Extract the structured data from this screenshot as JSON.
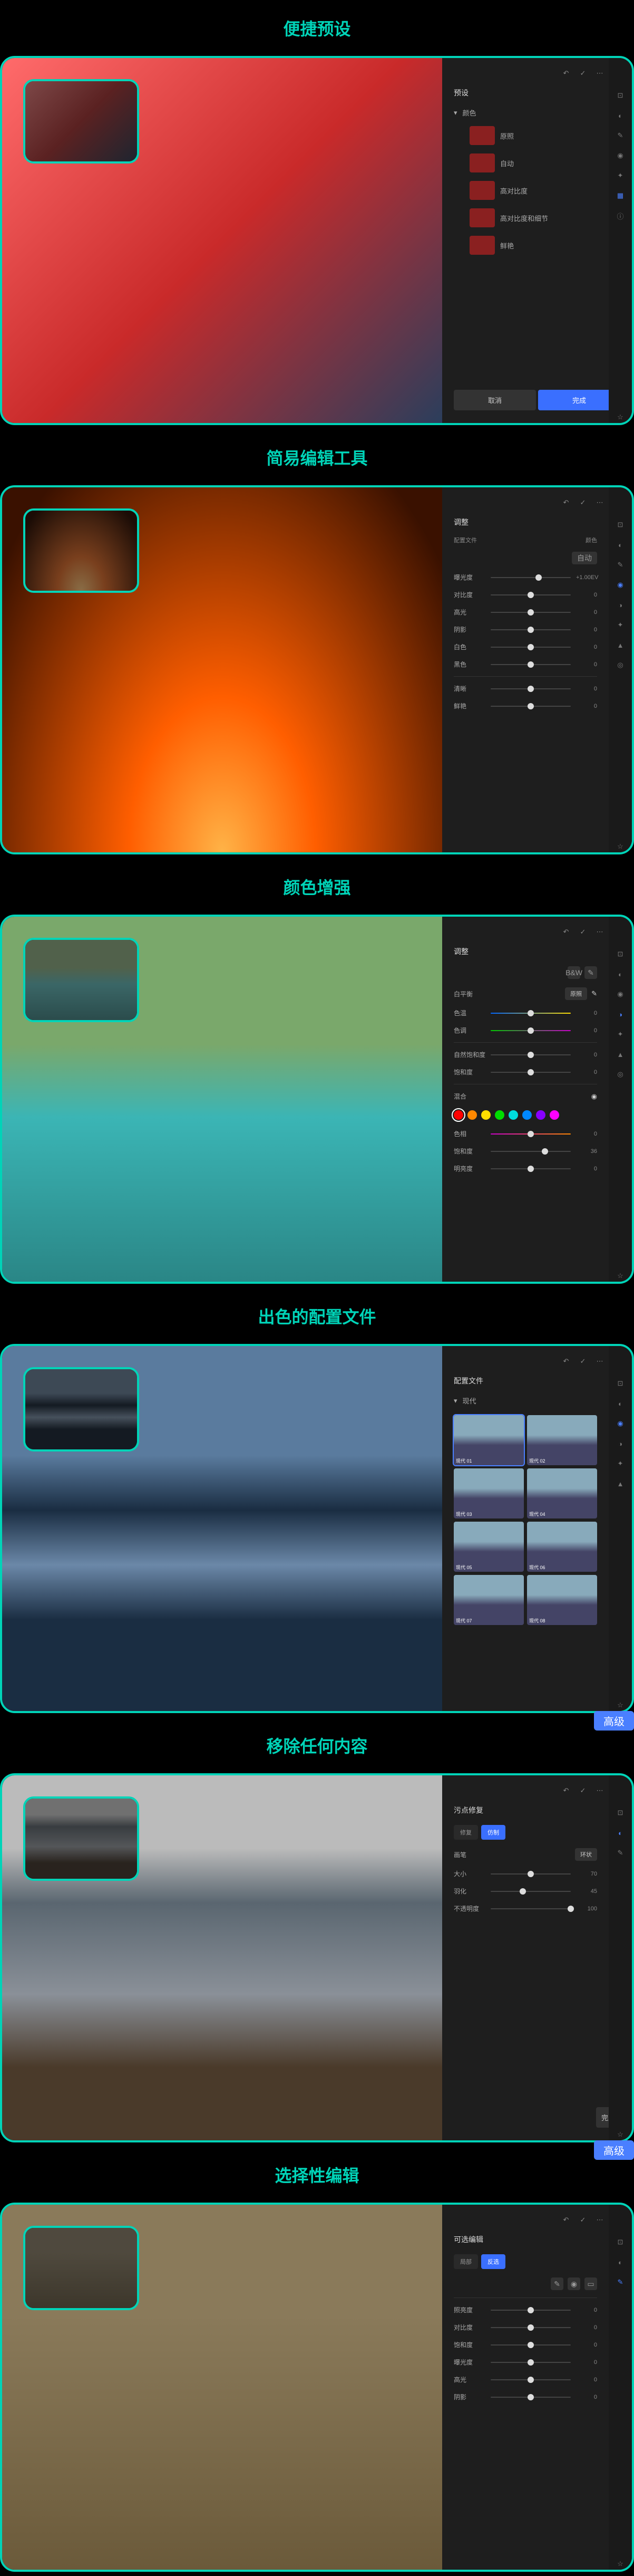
{
  "sections": [
    {
      "title": "便捷预设",
      "panel": {
        "heading": "预设",
        "category": "颜色",
        "presets": [
          "原照",
          "自动",
          "高对比度",
          "高对比度和细节",
          "鲜艳"
        ],
        "buttons": {
          "cancel": "取消",
          "done": "完成"
        }
      }
    },
    {
      "title": "简易编辑工具",
      "panel": {
        "heading": "调整",
        "profile": {
          "label": "配置文件",
          "value": "颜色"
        },
        "sliders": [
          {
            "label": "曝光度",
            "value": "+1.00EV",
            "pos": 60
          },
          {
            "label": "对比度",
            "value": "0",
            "pos": 50
          },
          {
            "label": "高光",
            "value": "0",
            "pos": 50
          },
          {
            "label": "阴影",
            "value": "0",
            "pos": 50
          },
          {
            "label": "白色",
            "value": "0",
            "pos": 50
          },
          {
            "label": "黑色",
            "value": "0",
            "pos": 50
          },
          {
            "label": "清晰",
            "value": "0",
            "pos": 50
          },
          {
            "label": "鲜艳",
            "value": "0",
            "pos": 50
          }
        ],
        "auto": "自动"
      }
    },
    {
      "title": "颜色增强",
      "panel": {
        "heading": "调整",
        "wb": {
          "label": "白平衡",
          "value": "原照"
        },
        "sliders_top": [
          {
            "label": "色温",
            "value": "0",
            "pos": 50
          },
          {
            "label": "色调",
            "value": "0",
            "pos": 50
          },
          {
            "label": "自然饱和度",
            "value": "0",
            "pos": 50
          },
          {
            "label": "饱和度",
            "value": "0",
            "pos": 50
          }
        ],
        "mix_label": "混合",
        "colors": [
          "#ff0000",
          "#ff8800",
          "#ffdd00",
          "#00dd00",
          "#00dddd",
          "#0088ff",
          "#8800ff",
          "#ff00ff"
        ],
        "sliders_bot": [
          {
            "label": "色相",
            "value": "0",
            "pos": 50
          },
          {
            "label": "饱和度",
            "value": "36",
            "pos": 68
          },
          {
            "label": "明亮度",
            "value": "0",
            "pos": 50
          }
        ]
      }
    },
    {
      "title": "出色的配置文件",
      "panel": {
        "heading": "配置文件",
        "category": "现代",
        "profiles": [
          "现代 01",
          "现代 02",
          "现代 03",
          "现代 04",
          "现代 05",
          "现代 06",
          "现代 07",
          "现代 08"
        ]
      }
    },
    {
      "title": "移除任何内容",
      "badge": "高级",
      "panel": {
        "heading": "污点修复",
        "buttons": {
          "heal": "修复",
          "clone": "仿制"
        },
        "brush": {
          "label": "画笔",
          "value": "环状"
        },
        "sliders": [
          {
            "label": "大小",
            "value": "70",
            "pos": 50
          },
          {
            "label": "羽化",
            "value": "45",
            "pos": 40
          },
          {
            "label": "不透明度",
            "value": "100",
            "pos": 100
          }
        ],
        "done": "完成"
      }
    },
    {
      "title": "选择性编辑",
      "badge": "高级",
      "panel": {
        "heading": "可选编辑",
        "buttons": {
          "local": "局部",
          "invert": "反选"
        },
        "sliders": [
          {
            "label": "照亮度",
            "value": "0",
            "pos": 50
          },
          {
            "label": "对比度",
            "value": "0",
            "pos": 50
          },
          {
            "label": "饱和度",
            "value": "0",
            "pos": 50
          },
          {
            "label": "曝光度",
            "value": "0",
            "pos": 50
          },
          {
            "label": "高光",
            "value": "0",
            "pos": 50
          },
          {
            "label": "阴影",
            "value": "0",
            "pos": 50
          }
        ]
      }
    }
  ]
}
